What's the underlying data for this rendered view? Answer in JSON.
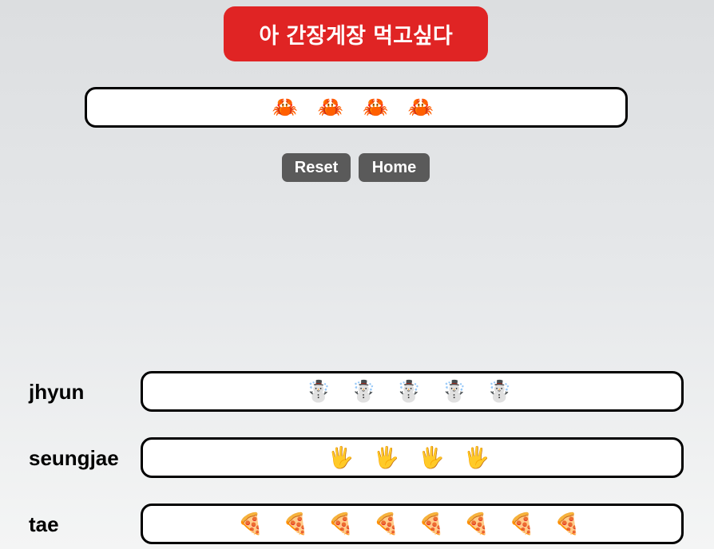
{
  "title": "아 간장게장 먹고싶다",
  "main_display": "🦀 🦀 🦀 🦀",
  "buttons": {
    "reset": "Reset",
    "home": "Home"
  },
  "players": [
    {
      "name": "jhyun",
      "emojis": "☃️ ☃️ ☃️ ☃️ ☃️"
    },
    {
      "name": "seungjae",
      "emojis": "🖐 🖐 🖐 🖐"
    },
    {
      "name": "tae",
      "emojis": "🍕 🍕 🍕 🍕 🍕 🍕 🍕 🍕"
    }
  ],
  "colors": {
    "title_background": "#e02424",
    "button_background": "#5a5a5a",
    "box_border": "#000000"
  }
}
